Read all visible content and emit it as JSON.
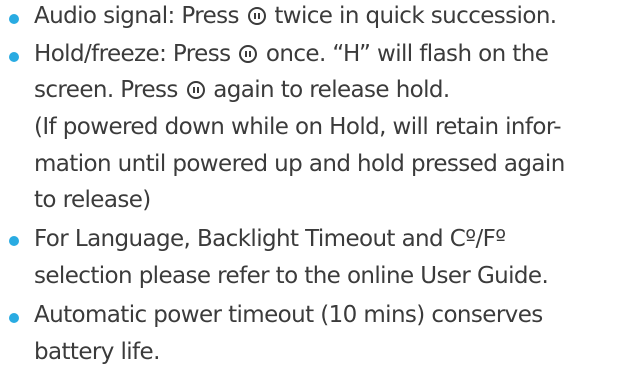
{
  "instructions": {
    "icons": {
      "bullet": "bullet-dot",
      "button": "hold-button-icon",
      "bullet_color": "#29abe2",
      "text_color": "#3b3b3b"
    },
    "items": [
      {
        "lines": [
          {
            "before": "Audio signal:  Press ",
            "after": " twice in quick succession."
          }
        ]
      },
      {
        "lines": [
          {
            "before": "Hold/freeze: Press ",
            "after": " once.  “H” will flash on the"
          },
          {
            "before": "screen. Press ",
            "after": " again to release hold."
          },
          {
            "text": "(If powered down while on Hold, will retain infor-"
          },
          {
            "text": "mation until powered up and hold pressed again"
          },
          {
            "text": "to release)"
          }
        ]
      },
      {
        "lines": [
          {
            "text": "For Language, Backlight Timeout and Cº/Fº"
          },
          {
            "text": "selection please refer to the online User Guide."
          }
        ]
      },
      {
        "lines": [
          {
            "text": "Automatic power timeout (10 mins) conserves"
          },
          {
            "text": " battery life."
          }
        ]
      }
    ]
  }
}
